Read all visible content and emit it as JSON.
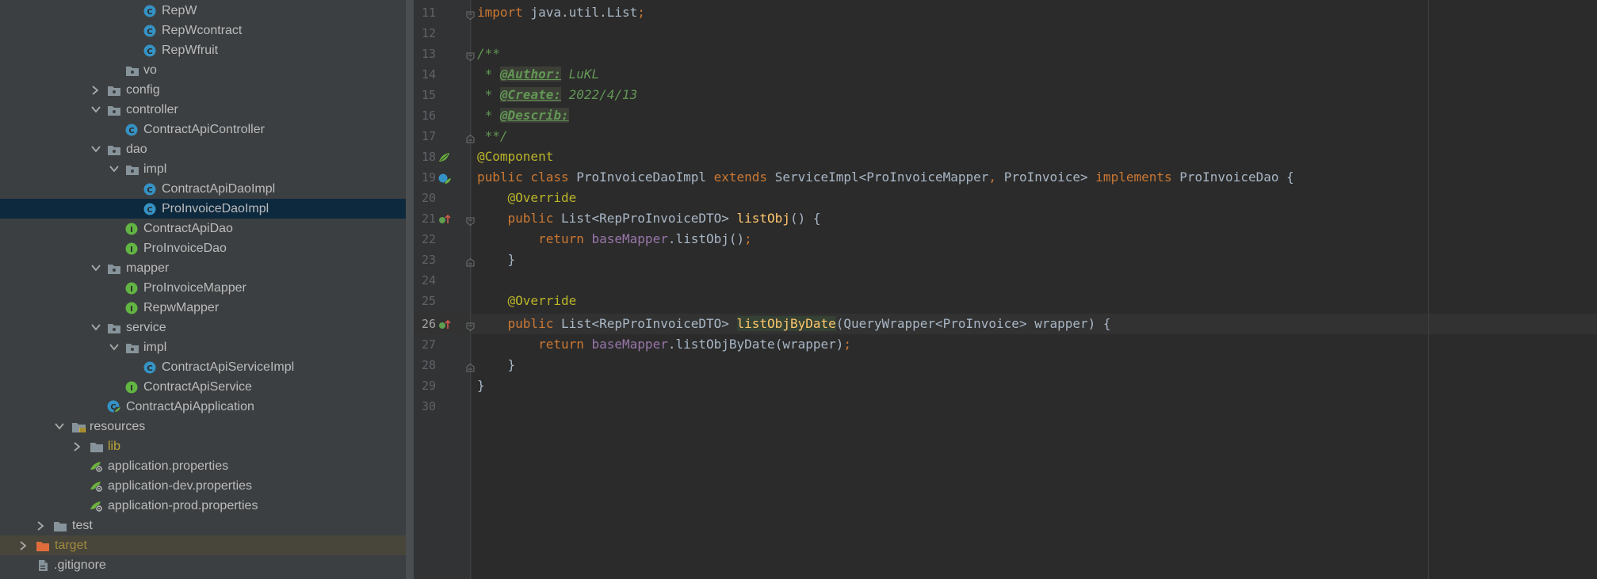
{
  "project_tree": {
    "items": [
      {
        "label": "RepW",
        "type": "class"
      },
      {
        "label": "RepWcontract",
        "type": "class"
      },
      {
        "label": "RepWfruit",
        "type": "class"
      },
      {
        "label": "vo",
        "type": "package"
      },
      {
        "label": "config",
        "type": "package",
        "state": "collapsed"
      },
      {
        "label": "controller",
        "type": "package",
        "state": "expanded"
      },
      {
        "label": "ContractApiController",
        "type": "class"
      },
      {
        "label": "dao",
        "type": "package",
        "state": "expanded"
      },
      {
        "label": "impl",
        "type": "package",
        "state": "expanded"
      },
      {
        "label": "ContractApiDaoImpl",
        "type": "class"
      },
      {
        "label": "ProInvoiceDaoImpl",
        "type": "class",
        "selected": true
      },
      {
        "label": "ContractApiDao",
        "type": "interface"
      },
      {
        "label": "ProInvoiceDao",
        "type": "interface"
      },
      {
        "label": "mapper",
        "type": "package",
        "state": "expanded"
      },
      {
        "label": "ProInvoiceMapper",
        "type": "interface"
      },
      {
        "label": "RepwMapper",
        "type": "interface"
      },
      {
        "label": "service",
        "type": "package",
        "state": "expanded"
      },
      {
        "label": "impl",
        "type": "package",
        "state": "expanded"
      },
      {
        "label": "ContractApiServiceImpl",
        "type": "class"
      },
      {
        "label": "ContractApiService",
        "type": "interface"
      },
      {
        "label": "ContractApiApplication",
        "type": "spring-boot-app"
      },
      {
        "label": "resources",
        "type": "resources-folder",
        "state": "expanded"
      },
      {
        "label": "lib",
        "type": "folder",
        "state": "collapsed"
      },
      {
        "label": "application.properties",
        "type": "spring-properties"
      },
      {
        "label": "application-dev.properties",
        "type": "spring-properties"
      },
      {
        "label": "application-prod.properties",
        "type": "spring-properties"
      },
      {
        "label": "test",
        "type": "folder",
        "state": "collapsed"
      },
      {
        "label": "target",
        "type": "excluded-folder",
        "state": "collapsed"
      },
      {
        "label": ".gitignore",
        "type": "file"
      }
    ]
  },
  "editor": {
    "current_line": "26",
    "lines": [
      {
        "num": "11"
      },
      {
        "num": "12"
      },
      {
        "num": "13"
      },
      {
        "num": "14"
      },
      {
        "num": "15"
      },
      {
        "num": "16"
      },
      {
        "num": "17"
      },
      {
        "num": "18"
      },
      {
        "num": "19"
      },
      {
        "num": "20"
      },
      {
        "num": "21"
      },
      {
        "num": "22"
      },
      {
        "num": "23"
      },
      {
        "num": "24"
      },
      {
        "num": "25"
      },
      {
        "num": "26"
      },
      {
        "num": "27"
      },
      {
        "num": "28"
      },
      {
        "num": "29"
      },
      {
        "num": "30"
      }
    ],
    "code": {
      "l11_kw": "import",
      "l11_rest": " java.util.List",
      "l11_semi": ";",
      "l13": "/**",
      "l14_pre": " * ",
      "l14_tag": "@Author:",
      "l14_val": " LuKL",
      "l15_pre": " * ",
      "l15_tag": "@Create:",
      "l15_val": " 2022/4/13",
      "l16_pre": " * ",
      "l16_tag": "@Describ:",
      "l17": " **/",
      "l18": "@Component",
      "l19_kw1": "public class",
      "l19_name": " ProInvoiceDaoImpl ",
      "l19_kw2": "extends",
      "l19_super": " ServiceImpl<ProInvoiceMapper",
      "l19_comma": ",",
      "l19_gen2": " ProInvoice> ",
      "l19_kw3": "implements",
      "l19_iface": " ProInvoiceDao {",
      "l20": "    @Override",
      "l21_indent": "    ",
      "l21_kw": "public",
      "l21_type": " List<RepProInvoiceDTO> ",
      "l21_fn": "listObj",
      "l21_rest": "() {",
      "l22_indent": "        ",
      "l22_kw": "return",
      "l22_sp": " ",
      "l22_fld": "baseMapper",
      "l22_rest": ".listObj()",
      "l22_semi": ";",
      "l23": "    }",
      "l25": "    @Override",
      "l26_indent": "    ",
      "l26_kw": "public",
      "l26_type": " List<RepProInvoiceDTO> ",
      "l26_fn": "listObjByDate",
      "l26_rest": "(QueryWrapper<ProInvoice> wrapper) {",
      "l27_indent": "        ",
      "l27_kw": "return",
      "l27_sp": " ",
      "l27_fld": "baseMapper",
      "l27_rest": ".listObjByDate(wrapper)",
      "l27_semi": ";",
      "l28": "    }",
      "l29": "}"
    }
  }
}
